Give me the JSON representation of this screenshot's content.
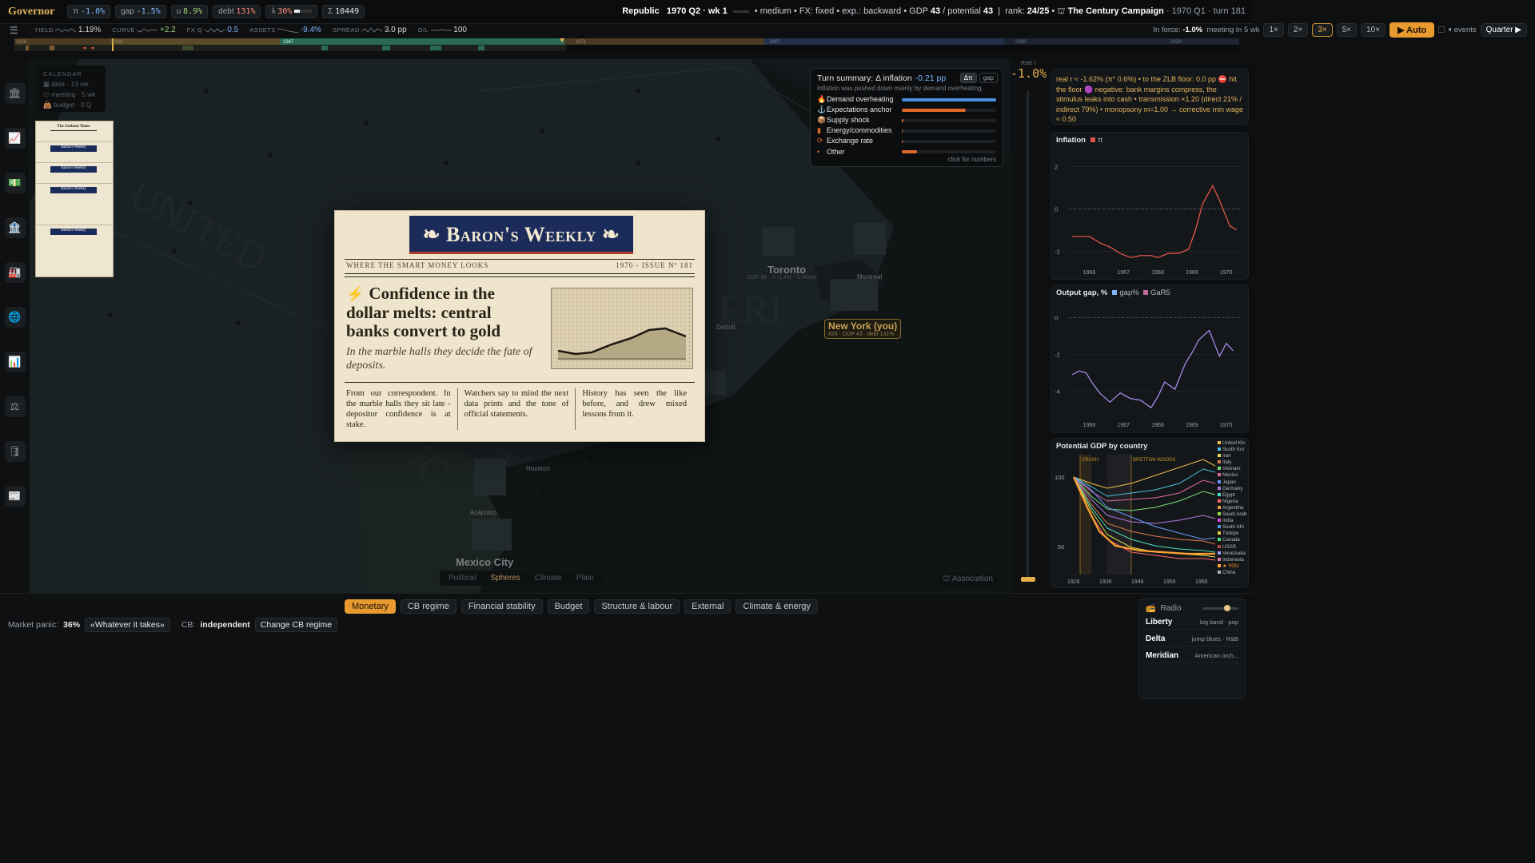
{
  "topbar": {
    "brand": "Governor",
    "pills": [
      {
        "label": "π",
        "value": "-1.0%",
        "color": "#7fb6ff"
      },
      {
        "label": "gap",
        "value": "-1.5%",
        "color": "#7fb6ff"
      },
      {
        "label": "u",
        "value": "8.9%",
        "color": "#9fd27a"
      },
      {
        "label": "debt",
        "value": "131%",
        "color": "#ff8a7a"
      },
      {
        "label": "λ",
        "value": "30%",
        "color": "#ff8a7a"
      },
      {
        "label": "Σ",
        "value": "10449",
        "color": "#e6e8ea"
      }
    ],
    "regime": "Republic",
    "period": "1970 Q2 · wk 1",
    "difficulty": "medium",
    "fx": "FX: fixed",
    "exp": "exp.: backward",
    "gdp_label": "GDP",
    "gdp": "43",
    "potential_label": "/ potential",
    "potential": "43",
    "rank_label": "rank:",
    "rank": "24/25",
    "campaign": "The Century Campaign",
    "campaign_meta": "· 1970 Q1 · turn 181"
  },
  "indicators": [
    {
      "key": "YIELD",
      "value": "1.19%"
    },
    {
      "key": "CURVE",
      "value": "+2.2"
    },
    {
      "key": "FX Q",
      "value": "0.5"
    },
    {
      "key": "ASSETS",
      "value": "-9.4%"
    },
    {
      "key": "SPREAD",
      "value": "3.0 pp"
    },
    {
      "key": "OIL",
      "value": "100"
    }
  ],
  "controls": {
    "in_force_label": "In force:",
    "in_force": "-1.0%",
    "meeting": "meeting in 5 wk",
    "speeds": [
      "1×",
      "2×",
      "3×",
      "5×",
      "10×"
    ],
    "active_speed": "3×",
    "auto": "▶ Auto",
    "events": "events",
    "quarter": "Quarter ▶"
  },
  "timeline": {
    "labels": [
      "1926",
      "1933",
      "1947",
      "1971",
      "1987",
      "2008",
      "2020"
    ]
  },
  "calendar": {
    "title": "CALENDAR",
    "items": [
      "data · 13 wk",
      "meeting · 5 wk",
      "budget · 3 Q"
    ]
  },
  "thumbnails": {
    "first": "The Gotham Times",
    "paper": "Baron's Weekly",
    "count": 6
  },
  "newspaper": {
    "masthead": "❧ Baron's Weekly ❧",
    "tagline": "WHERE THE SMART MONEY LOOKS",
    "issue": "1970 - ISSUE Nº 181",
    "headline": "Confidence in the dollar melts: central banks convert to gold",
    "dek": "In the marble halls they decide the fate of deposits.",
    "columns": [
      "From our correspondent. In the marble halls they sit late - depositor confidence is at stake.",
      "Watchers say to mind the next data prints and the tone of official statements.",
      "History has seen the like before, and drew mixed lessons from it."
    ]
  },
  "turn_summary": {
    "title": "Turn summary: Δ inflation",
    "delta": "-0.21 pp",
    "tabs": [
      "Δπ",
      "gap"
    ],
    "sub": "Inflation was pushed down mainly by demand overheating.",
    "items": [
      {
        "label": "Demand overheating",
        "icon": "🔥",
        "share": 1.0,
        "color": "#4a8fe0"
      },
      {
        "label": "Expectations anchor",
        "icon": "⚓",
        "share": 0.68,
        "color": "#e06a2a"
      },
      {
        "label": "Supply shock",
        "icon": "📦",
        "share": 0.02,
        "color": "#e06a2a"
      },
      {
        "label": "Energy/commodities",
        "icon": "▮",
        "share": 0.01,
        "color": "#e06a2a"
      },
      {
        "label": "Exchange rate",
        "icon": "⟳",
        "share": 0.01,
        "color": "#e06a2a"
      },
      {
        "label": "Other",
        "icon": "•",
        "share": 0.16,
        "color": "#e06a2a"
      }
    ],
    "hint": "click for numbers"
  },
  "map": {
    "cities": [
      {
        "name": "Toronto",
        "cls": "big"
      },
      {
        "name": "Montreal",
        "cls": ""
      },
      {
        "name": "Detroit",
        "cls": ""
      },
      {
        "name": "Houston",
        "cls": ""
      },
      {
        "name": "Acapulco",
        "cls": ""
      },
      {
        "name": "Mexico City",
        "cls": "big"
      }
    ],
    "toronto_meta": "GDP 49 · π -1.4% · C Home",
    "ny_name": "New York (you)",
    "ny_meta": "#24 · GDP 43 · debt 131%",
    "overlay_tabs": [
      "Political",
      "Spheres",
      "Climate",
      "Plain"
    ],
    "active_overlay": "Spheres",
    "association": "Association"
  },
  "rate": {
    "label": "Rate i",
    "value": "-1.0%"
  },
  "policy_note": "real r ≈ -1.62% (π° 0.6%) • to the ZLB floor: 0.0 pp ⛔ hit the floor 🟣 negative: bank margins compress, the stimulus leaks into cash • transmission ×1.20 (direct 21% / indirect 79%) • monopsony m=1.00 → corrective min wage ≈ 0.50",
  "inflation_chart": {
    "title": "Inflation",
    "legend": "π",
    "ticks_y": [
      "2",
      "0",
      "-2"
    ],
    "ticks_x": [
      "1966",
      "1967",
      "1968",
      "1969",
      "1970"
    ]
  },
  "gap_chart": {
    "title": "Output gap, %",
    "legend": [
      "gap%",
      "GaR5"
    ],
    "ticks_y": [
      "0",
      "-2",
      "-4"
    ],
    "ticks_x": [
      "1966",
      "1967",
      "1968",
      "1969",
      "1970"
    ]
  },
  "pgdp_chart": {
    "title": "Potential GDP by country",
    "annotations": [
      "CRASH",
      "BRETTON WOODS"
    ],
    "ticks_y": [
      "100",
      "50"
    ],
    "ticks_x": [
      "1926",
      "1936",
      "1946",
      "1956",
      "1966"
    ],
    "countries": [
      "United Kin",
      "South Kor",
      "Iran",
      "Italy",
      "Vietnam",
      "Mexico",
      "Japan",
      "Germany",
      "Egypt",
      "Nigeria",
      "Argentina",
      "Saudi Arab",
      "India",
      "South Afri",
      "Türkiye",
      "Canada",
      "USSR",
      "Venezuela",
      "Indonesia",
      "★ YOU",
      "China"
    ]
  },
  "chart_data": [
    {
      "type": "line",
      "title": "Inflation",
      "series": [
        {
          "name": "π",
          "x": [
            1965.5,
            1965.8,
            1966.0,
            1966.3,
            1966.6,
            1966.9,
            1967.2,
            1967.5,
            1967.8,
            1968.0,
            1968.3,
            1968.6,
            1968.9,
            1969.1,
            1969.3,
            1969.6,
            1969.8,
            1970.1,
            1970.3
          ],
          "values": [
            -1.3,
            -1.3,
            -1.3,
            -1.6,
            -1.8,
            -2.1,
            -2.3,
            -2.2,
            -2.2,
            -2.3,
            -2.1,
            -2.1,
            -1.9,
            -1.0,
            0.2,
            1.1,
            0.4,
            -0.8,
            -1.0
          ]
        }
      ],
      "ylim": [
        -2.7,
        2.5
      ]
    },
    {
      "type": "line",
      "title": "Output gap, %",
      "series": [
        {
          "name": "gap%",
          "x": [
            1965.5,
            1965.7,
            1965.9,
            1966.1,
            1966.3,
            1966.6,
            1966.9,
            1967.2,
            1967.5,
            1967.8,
            1968.0,
            1968.2,
            1968.5,
            1968.8,
            1969.0,
            1969.2,
            1969.5,
            1969.8,
            1970.0,
            1970.2
          ],
          "values": [
            -3.1,
            -2.9,
            -3.0,
            -3.6,
            -4.1,
            -4.6,
            -4.1,
            -4.4,
            -4.5,
            -4.9,
            -4.3,
            -3.5,
            -3.9,
            -2.5,
            -1.9,
            -1.2,
            -0.7,
            -2.1,
            -1.4,
            -1.8
          ]
        }
      ],
      "ylim": [
        -5.5,
        0.5
      ]
    }
  ],
  "bottom": {
    "tabs": [
      "Monetary",
      "CB regime",
      "Financial stability",
      "Budget",
      "Structure & labour",
      "External",
      "Climate & energy"
    ],
    "active_tab": "Monetary",
    "panic_label": "Market panic:",
    "panic": "36%",
    "whatever": "«Whatever it takes»",
    "cb_label": "CB:",
    "cb": "independent",
    "change_cb": "Change CB regime"
  },
  "radio": {
    "title": "Radio",
    "stations": [
      {
        "name": "Liberty",
        "genre": "big band · pop"
      },
      {
        "name": "Delta",
        "genre": "jump blues · R&B"
      },
      {
        "name": "Meridian",
        "genre": "American orch..."
      }
    ]
  }
}
